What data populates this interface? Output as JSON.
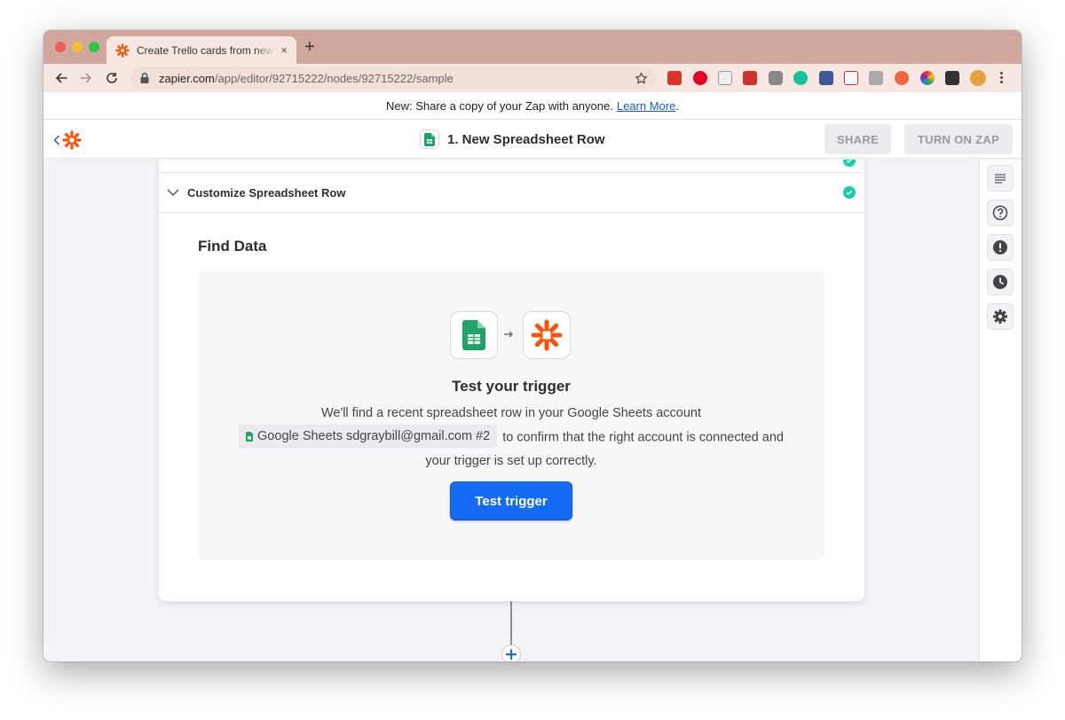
{
  "browser": {
    "tab_title": "Create Trello cards from new ro",
    "url_host": "zapier.com",
    "url_path": "/app/editor/92715222/nodes/92715222/sample",
    "tab_close": "×",
    "new_tab": "+"
  },
  "banner": {
    "text": "New: Share a copy of your Zap with anyone.",
    "link": "Learn More",
    "trailing": "."
  },
  "header": {
    "title": "1. New Spreadsheet Row",
    "share": "SHARE",
    "turn_on": "TURN ON ZAP"
  },
  "section": {
    "label": "Customize Spreadsheet Row"
  },
  "find_data": {
    "heading": "Find Data",
    "test_title": "Test your trigger",
    "desc_line1": "We'll find a recent spreadsheet row in your Google Sheets account",
    "account": "Google Sheets sdgraybill@gmail.com #2",
    "desc_line2": "to confirm that the right account is connected and",
    "desc_line3": "your trigger is set up correctly.",
    "button": "Test trigger"
  },
  "colors": {
    "brand_orange": "#ff4f00",
    "primary_blue": "#136bf5",
    "success_green": "#13d0ab",
    "sheets_green": "#1fa463"
  },
  "icons": {
    "rail": [
      "details-icon",
      "help-icon",
      "alert-icon",
      "history-icon",
      "settings-icon"
    ]
  }
}
